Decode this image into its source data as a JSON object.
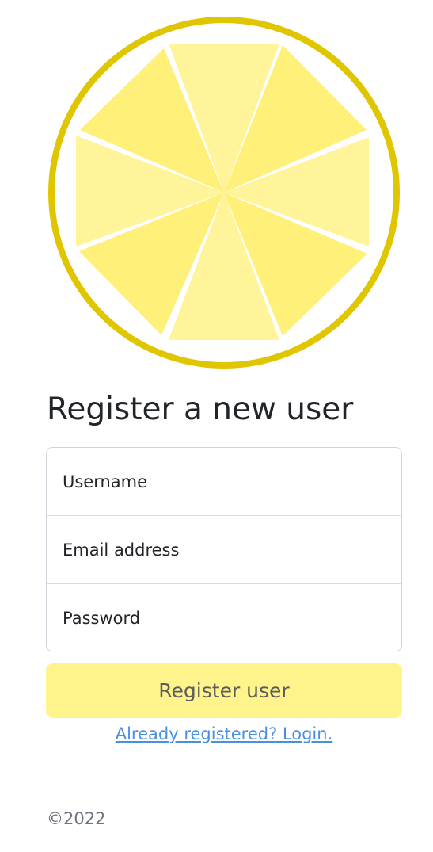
{
  "logo": {
    "icon": "lemon-slice-icon",
    "rim_color": "#e0c600",
    "segment_color_a": "#fff07a",
    "segment_color_b": "#fff49a"
  },
  "page": {
    "title": "Register a new user"
  },
  "form": {
    "username_placeholder": "Username",
    "email_placeholder": "Email address",
    "password_placeholder": "Password",
    "submit_label": "Register user",
    "submit_color": "#fff48b"
  },
  "links": {
    "login": "Already registered? Login."
  },
  "footer": {
    "copyright": "©2022"
  }
}
